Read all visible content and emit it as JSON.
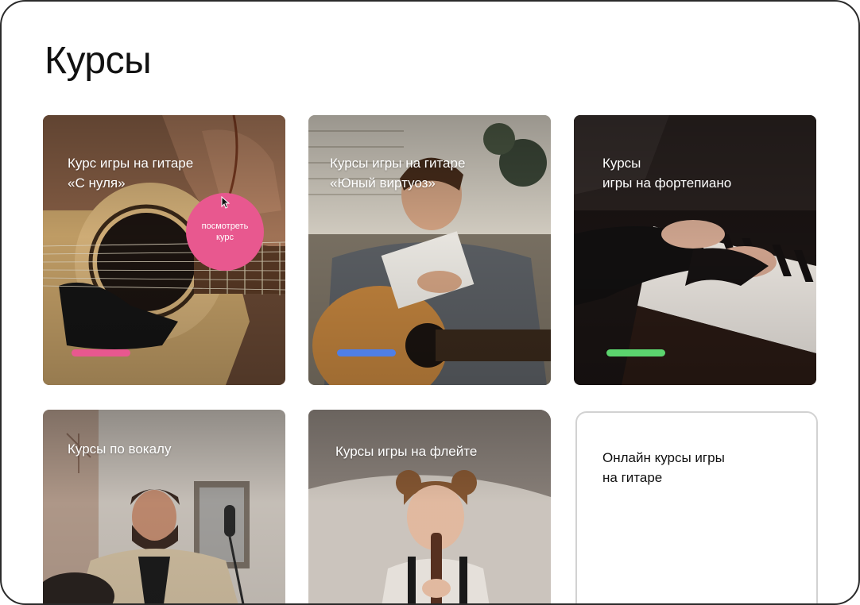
{
  "page": {
    "title": "Курсы"
  },
  "courses": [
    {
      "title": "Курс игры на гитаре\n«С нуля»",
      "bar_color": "#e8588f",
      "cta_label": "посмотреть\nкурс"
    },
    {
      "title": "Курсы игры на гитаре\n«Юный виртуоз»",
      "bar_color": "#4f7fe6"
    },
    {
      "title": "Курсы\nигры на фортепиано",
      "bar_color": "#5bd46e"
    },
    {
      "title": "Курсы по вокалу"
    },
    {
      "title": "Курсы игры на флейте"
    }
  ],
  "online_card": {
    "title": "Онлайн курсы игры\nна гитаре"
  },
  "colors": {
    "accent_pink": "#e8588f",
    "accent_blue": "#4f7fe6",
    "accent_green": "#5bd46e",
    "frame_border": "#2a2a2a"
  },
  "icons": {
    "cursor": "mouse-pointer-icon"
  }
}
